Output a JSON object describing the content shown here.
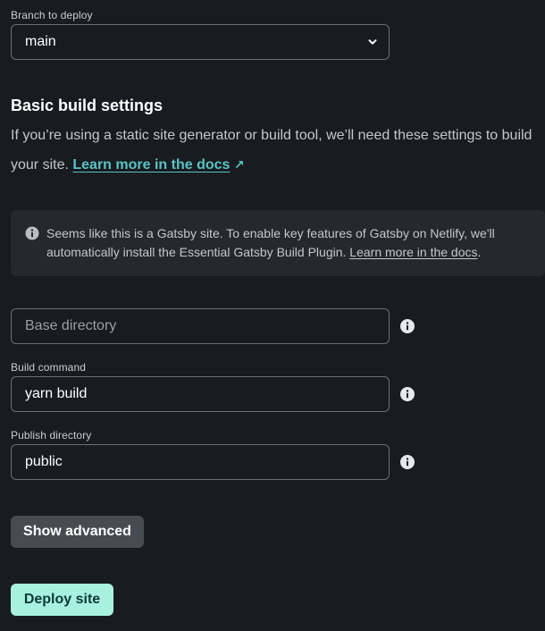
{
  "branch": {
    "label": "Branch to deploy",
    "value": "main"
  },
  "build_settings": {
    "title": "Basic build settings",
    "description": "If you’re using a static site generator or build tool, we’ll need these settings to build your site.",
    "docs_link": "Learn more in the docs",
    "docs_arrow": "↗"
  },
  "callout": {
    "text": "Seems like this is a Gatsby site. To enable key features of Gatsby on Netlify, we'll automatically install the Essential Gatsby Build Plugin.",
    "link": "Learn more in the docs",
    "trailing": "."
  },
  "fields": {
    "base_directory": {
      "placeholder": "Base directory",
      "value": ""
    },
    "build_command": {
      "label": "Build command",
      "value": "yarn build"
    },
    "publish_directory": {
      "label": "Publish directory",
      "value": "public"
    }
  },
  "buttons": {
    "show_advanced": "Show advanced",
    "deploy": "Deploy site"
  },
  "colors": {
    "background": "#181b20",
    "accent_link": "#5bc4c4",
    "primary_button": "#a8f0e0"
  }
}
